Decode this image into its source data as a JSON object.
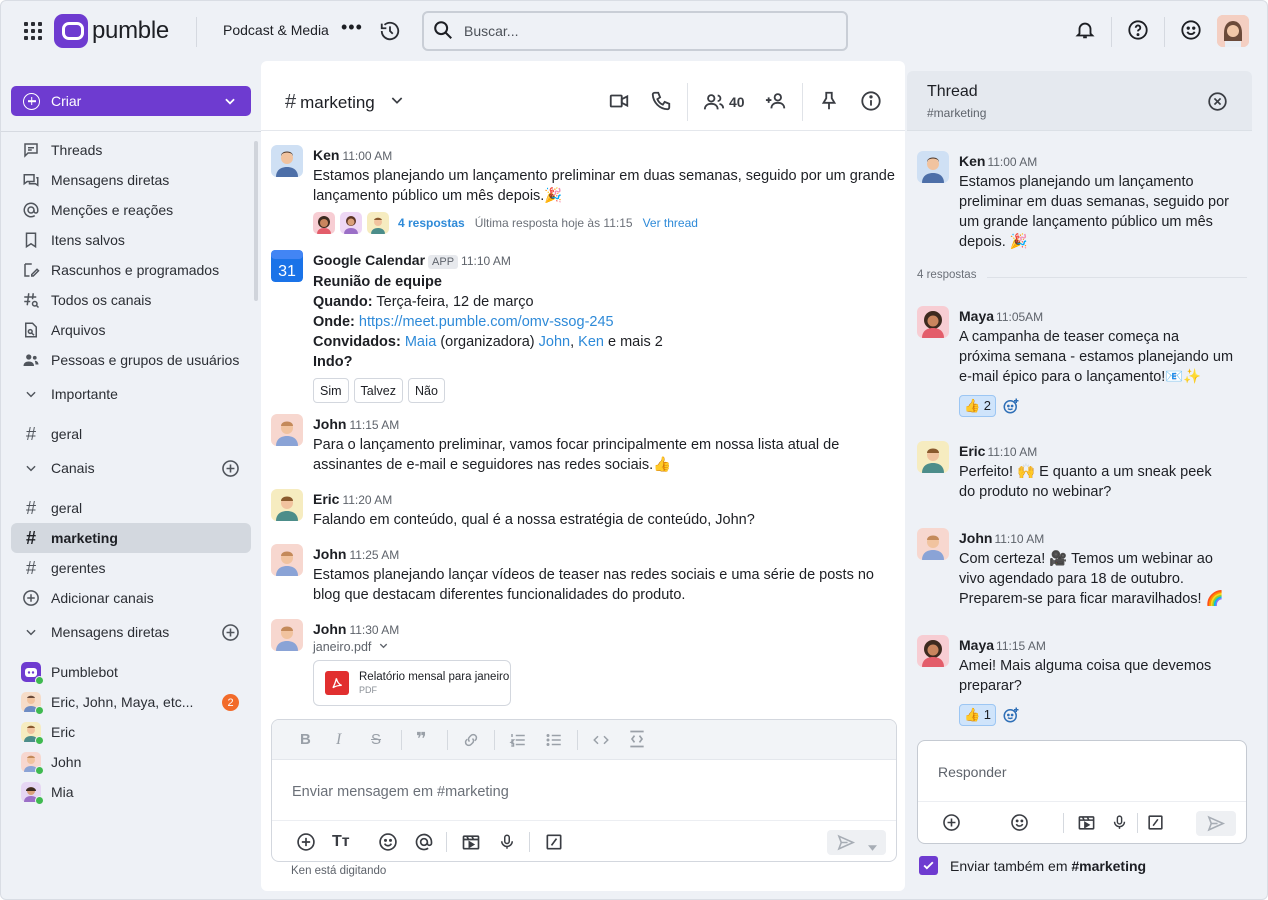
{
  "topbar": {
    "brand": "pumble",
    "workspace": "Podcast & Media",
    "more": "•••",
    "search_placeholder": "Buscar..."
  },
  "sidebar": {
    "create_label": "Criar",
    "nav": [
      {
        "label": "Threads",
        "icon": "threads-icon"
      },
      {
        "label": "Mensagens diretas",
        "icon": "direct-messages-icon"
      },
      {
        "label": "Menções e reações",
        "icon": "at-icon"
      },
      {
        "label": "Itens salvos",
        "icon": "bookmark-icon"
      },
      {
        "label": "Rascunhos e programados",
        "icon": "drafts-icon"
      },
      {
        "label": "Todos os canais",
        "icon": "channels-search-icon"
      },
      {
        "label": "Arquivos",
        "icon": "files-icon"
      },
      {
        "label": "Pessoas e grupos de usuários",
        "icon": "people-icon"
      }
    ],
    "important_label": "Importante",
    "important_channels": [
      "geral"
    ],
    "channels_label": "Canais",
    "channels": [
      "geral",
      "marketing",
      "gerentes"
    ],
    "add_channels": "Adicionar canais",
    "dms_label": "Mensagens diretas",
    "dms": [
      {
        "name": "Pumblebot",
        "badge": ""
      },
      {
        "name": "Eric, John, Maya, etc...",
        "badge": "2"
      },
      {
        "name": "Eric",
        "badge": ""
      },
      {
        "name": "John",
        "badge": ""
      },
      {
        "name": "Mia",
        "badge": ""
      }
    ]
  },
  "channel": {
    "name": "marketing",
    "members_count": "40"
  },
  "messages": [
    {
      "author": "Ken",
      "time": "11:00 AM",
      "text": "Estamos planejando um lançamento preliminar em duas semanas, seguido por um grande lançamento público um mês depois.🎉",
      "replies": "4 respostas",
      "last_reply": "Última resposta hoje às 11:15",
      "view_thread": "Ver thread"
    },
    {
      "author": "Google Calendar",
      "tag": "APP",
      "time": "11:10 AM",
      "event_title": "Reunião de equipe",
      "when_label": "Quando:",
      "when": "Terça-feira, 12 de março",
      "where_label": "Onde:",
      "where": "https://meet.pumble.com/omv-ssog-245",
      "guests_label": "Convidados:",
      "guest1": "Maia",
      "guest1_note": "(organizadora)",
      "guest2": "John",
      "guest3": "Ken",
      "guests_more": "e mais 2",
      "going": "Indo?",
      "options": [
        "Sim",
        "Talvez",
        "Não"
      ],
      "calendar_day": "31"
    },
    {
      "author": "John",
      "time": "11:15 AM",
      "text": "Para o lançamento preliminar, vamos focar principalmente em nossa lista atual de assinantes de e-mail e seguidores nas redes sociais.👍"
    },
    {
      "author": "Eric",
      "time": "11:20 AM",
      "text": "Falando em conteúdo, qual é a nossa estratégia de conteúdo, John?"
    },
    {
      "author": "John",
      "time": "11:25 AM",
      "text": "Estamos planejando lançar vídeos de teaser nas redes sociais e uma série de posts no blog que destacam diferentes funcionalidades do produto."
    },
    {
      "author": "John",
      "time": "11:30 AM",
      "file_name": "janeiro.pdf",
      "file_title": "Relatório mensal para janeiro",
      "file_type": "PDF"
    }
  ],
  "composer": {
    "placeholder": "Enviar mensagem em #marketing",
    "typing": "Ken está digitando"
  },
  "thread": {
    "title": "Thread",
    "subtitle": "#marketing",
    "root": {
      "author": "Ken",
      "time": "11:00 AM",
      "text": "Estamos planejando um lançamento preliminar em duas semanas, seguido por um grande lançamento público um mês depois. 🎉"
    },
    "replies_count": "4 respostas",
    "replies": [
      {
        "author": "Maya",
        "time": "11:05AM",
        "text": "A campanha de teaser começa na próxima semana - estamos planejando um e-mail épico para o lançamento!📧✨",
        "reaction": "👍 2"
      },
      {
        "author": "Eric",
        "time": "11:10 AM",
        "text": "Perfeito! 🙌 E quanto a um sneak peek do produto no webinar?",
        "reaction": ""
      },
      {
        "author": "John",
        "time": "11:10 AM",
        "text": "Com certeza! 🎥 Temos um webinar ao vivo agendado para 18 de outubro. Preparem-se para ficar maravilhados! 🌈",
        "reaction": ""
      },
      {
        "author": "Maya",
        "time": "11:15 AM",
        "text": "Amei! Mais alguma coisa que devemos preparar?",
        "reaction": "👍 1"
      }
    ],
    "reply_placeholder": "Responder",
    "also_send": "Enviar também em ",
    "also_send_channel": "#marketing"
  },
  "colors": {
    "brand": "#6e3bd0",
    "link": "#2e8ad8",
    "badge": "#f26b2a"
  }
}
